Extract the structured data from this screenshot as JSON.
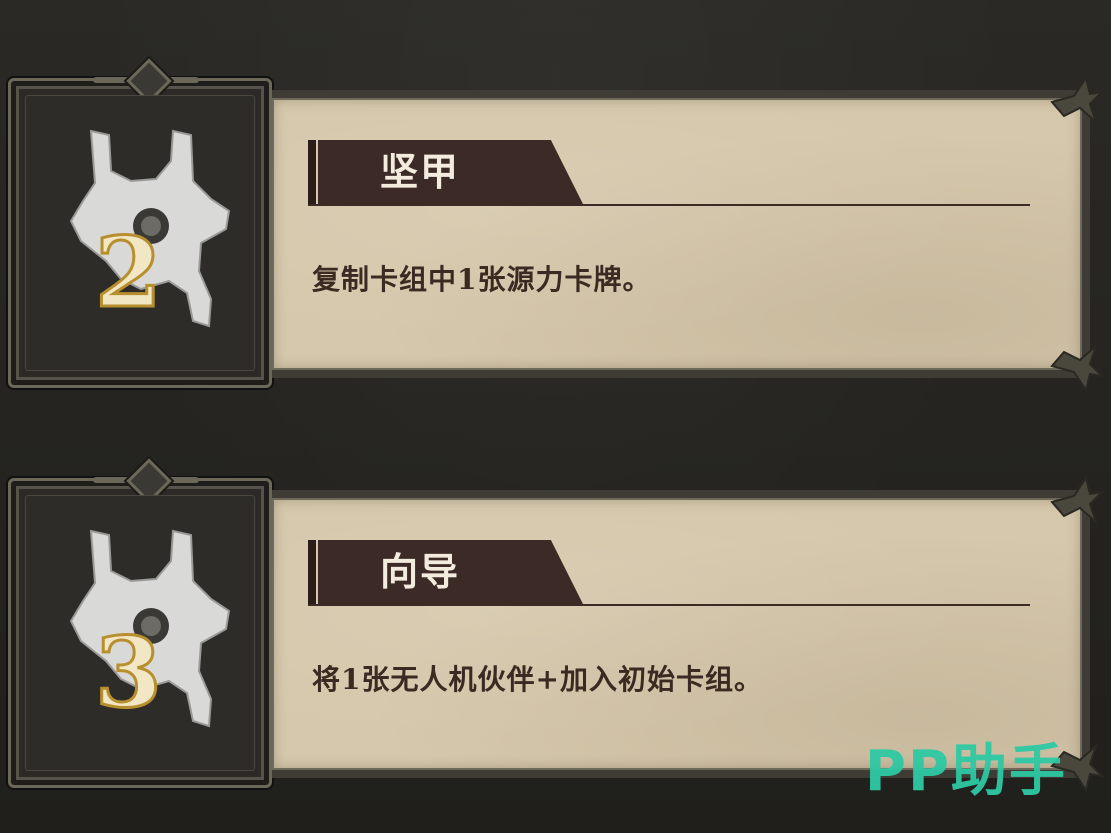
{
  "upgrades": [
    {
      "title": "坚甲",
      "description": "复制卡组中1张源力卡牌。",
      "level_numeral": "2"
    },
    {
      "title": "向导",
      "description": "将1张无人机伙伴+加入初始卡组。",
      "level_numeral": "3"
    }
  ],
  "watermark": "PP助手",
  "colors": {
    "background": "#24231f",
    "parchment": "#d6c8ac",
    "banner": "#3b2a26",
    "frame": "#6b685a",
    "icon_metal": "#d9d9d7",
    "numeral_gold": "#e9c97a",
    "watermark": "#2ec9a4"
  },
  "icons": [
    "claw-gear-icon",
    "numeral-badge-icon",
    "thorn-corner-icon"
  ]
}
